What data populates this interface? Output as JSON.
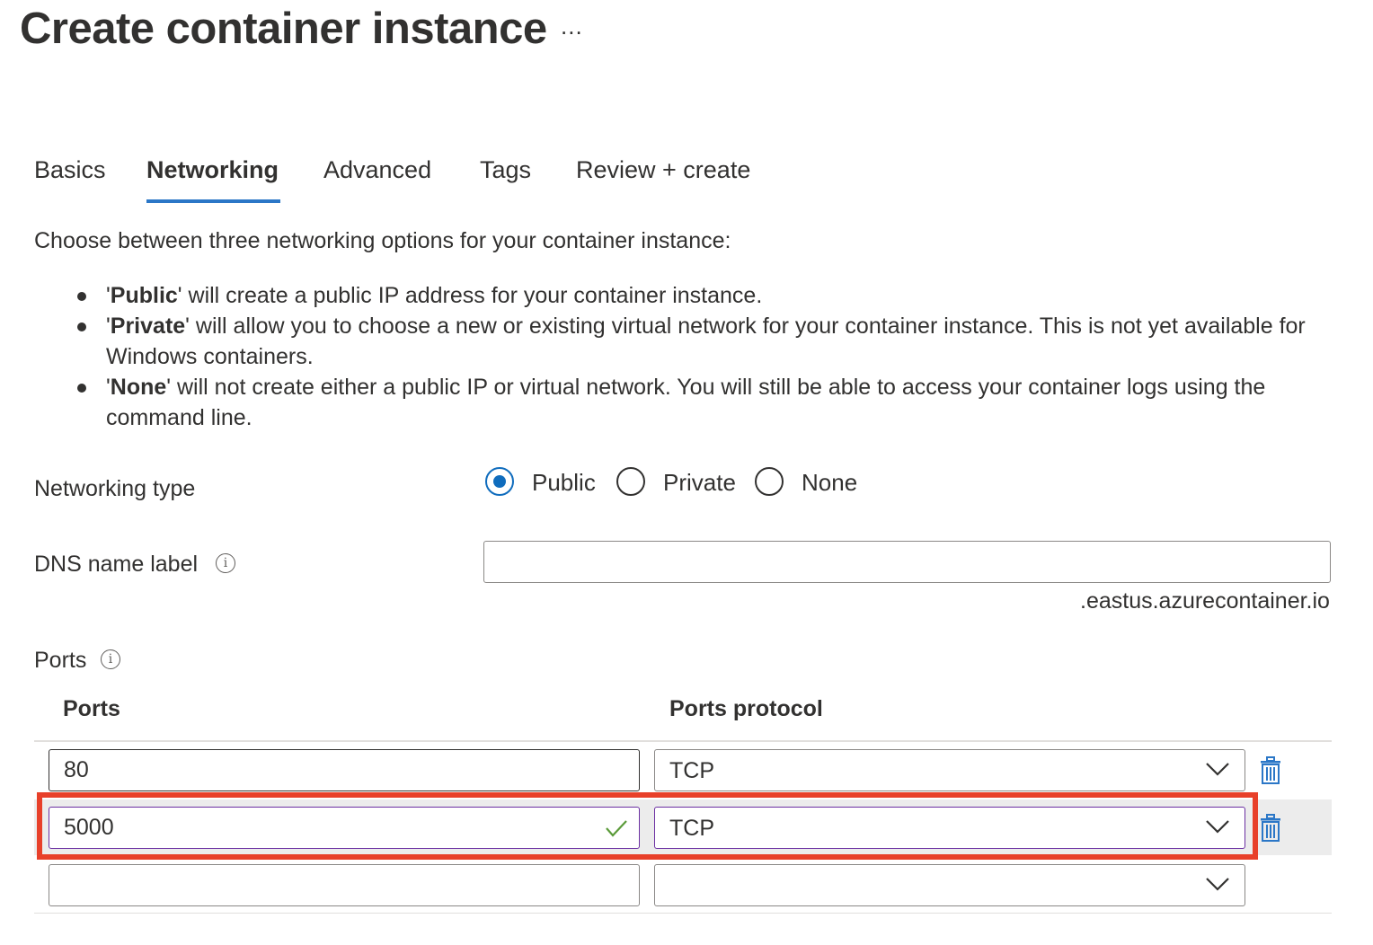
{
  "header": {
    "title": "Create container instance",
    "more_label": "..."
  },
  "tabs": [
    {
      "label": "Basics",
      "active": false
    },
    {
      "label": "Networking",
      "active": true
    },
    {
      "label": "Advanced",
      "active": false
    },
    {
      "label": "Tags",
      "active": false
    },
    {
      "label": "Review + create",
      "active": false
    }
  ],
  "intro": {
    "text": "Choose between three networking options for your container instance:",
    "bullets": [
      {
        "term": "Public",
        "text": "' will create a public IP address for your container instance."
      },
      {
        "term": "Private",
        "text": "' will allow you to choose a new or existing virtual network for your container instance. This is not yet available for Windows containers."
      },
      {
        "term": "None",
        "text": "' will not create either a public IP or virtual network. You will still be able to access your container logs using the command line."
      }
    ]
  },
  "networking_type": {
    "label": "Networking type",
    "options": [
      "Public",
      "Private",
      "None"
    ],
    "selected": "Public"
  },
  "dns": {
    "label": "DNS name label",
    "value": "",
    "suffix": ".eastus.azurecontainer.io",
    "info_icon": "info-icon"
  },
  "ports": {
    "label": "Ports",
    "info_icon": "info-icon",
    "col_ports": "Ports",
    "col_protocol": "Ports protocol",
    "rows": [
      {
        "port": "80",
        "protocol": "TCP"
      },
      {
        "port": "5000",
        "protocol": "TCP"
      },
      {
        "port": "",
        "protocol": ""
      }
    ]
  },
  "colors": {
    "accent": "#0f6cbd",
    "tab_underline": "#2b77c7",
    "focus_border": "#6b2fa2",
    "valid_check": "#5b9b3a",
    "highlight": "#e8402a",
    "trash_icon": "#2b77c7"
  }
}
